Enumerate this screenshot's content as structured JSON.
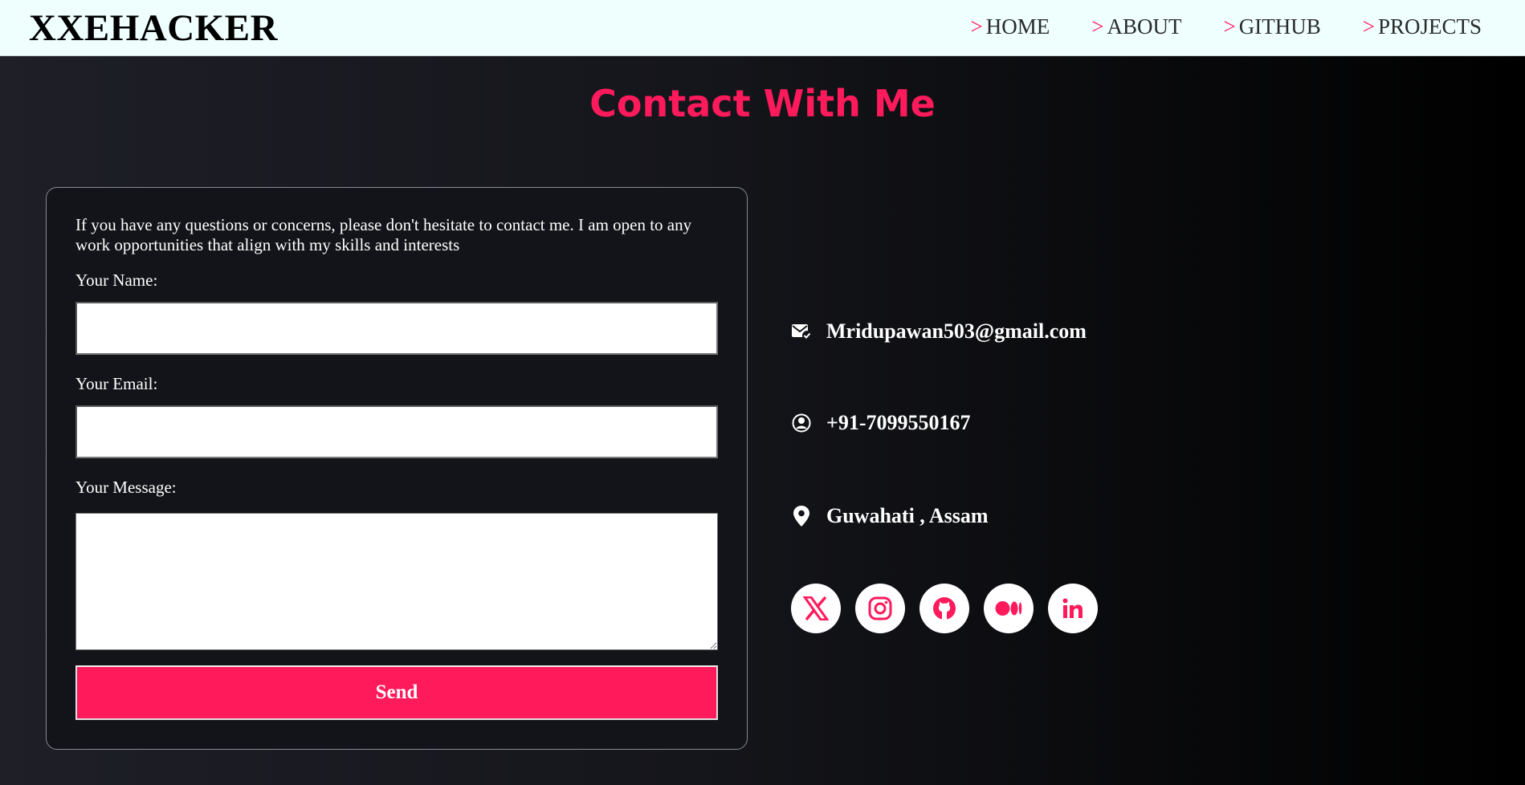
{
  "navbar": {
    "brand": "XXEHACKER",
    "links": [
      {
        "prefix": ">",
        "label": "HOME"
      },
      {
        "prefix": ">",
        "label": "ABOUT"
      },
      {
        "prefix": ">",
        "label": "GITHUB"
      },
      {
        "prefix": ">",
        "label": "PROJECTS"
      }
    ]
  },
  "main": {
    "title": "Contact With Me",
    "form": {
      "intro": "If you have any questions or concerns, please don't hesitate to contact me. I am open to any work opportunities that align with my skills and interests",
      "name_label": "Your Name:",
      "name_value": "",
      "email_label": "Your Email:",
      "email_value": "",
      "message_label": "Your Message:",
      "message_value": "",
      "send_label": "Send"
    },
    "contact_info": {
      "email": "Mridupawan503@gmail.com",
      "phone": "+91-7099550167",
      "location": "Guwahati , Assam",
      "email_icon": "mail-check-icon",
      "phone_icon": "phone-circle-icon",
      "location_icon": "map-pin-icon"
    },
    "socials": [
      {
        "name": "x-twitter",
        "icon": "x-logo-icon"
      },
      {
        "name": "instagram",
        "icon": "instagram-icon"
      },
      {
        "name": "github",
        "icon": "github-icon"
      },
      {
        "name": "medium",
        "icon": "medium-icon"
      },
      {
        "name": "linkedin",
        "icon": "linkedin-icon"
      }
    ]
  },
  "colors": {
    "accent": "#ff1a5c",
    "navbar_bg": "#effffe",
    "card_bg": "#131419",
    "text": "#ffffff"
  }
}
